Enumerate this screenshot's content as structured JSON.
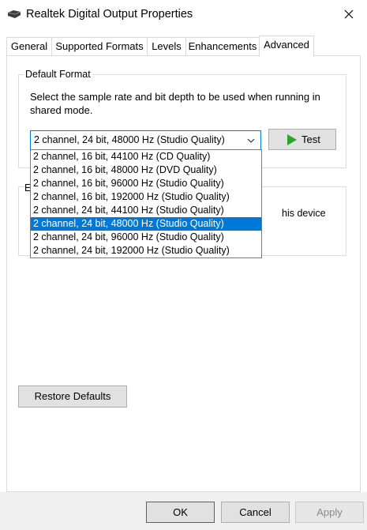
{
  "window": {
    "title": "Realtek Digital Output Properties",
    "icon": "speaker-device-icon"
  },
  "tabs": [
    {
      "label": "General",
      "active": false
    },
    {
      "label": "Supported Formats",
      "active": false
    },
    {
      "label": "Levels",
      "active": false
    },
    {
      "label": "Enhancements",
      "active": false
    },
    {
      "label": "Advanced",
      "active": true
    }
  ],
  "default_format": {
    "group_label": "Default Format",
    "description": "Select the sample rate and bit depth to be used when running in shared mode.",
    "selected_value": "2 channel, 24 bit, 48000 Hz (Studio Quality)",
    "test_button": "Test",
    "options": [
      "2 channel, 16 bit, 44100 Hz (CD Quality)",
      "2 channel, 16 bit, 48000 Hz (DVD Quality)",
      "2 channel, 16 bit, 96000 Hz (Studio Quality)",
      "2 channel, 16 bit, 192000 Hz (Studio Quality)",
      "2 channel, 24 bit, 44100 Hz (Studio Quality)",
      "2 channel, 24 bit, 48000 Hz (Studio Quality)",
      "2 channel, 24 bit, 96000 Hz (Studio Quality)",
      "2 channel, 24 bit, 192000 Hz (Studio Quality)"
    ],
    "selected_index": 5
  },
  "exclusive_mode": {
    "group_label_partial": "E",
    "partial_text": "his device"
  },
  "buttons": {
    "restore_defaults": "Restore Defaults",
    "ok": "OK",
    "cancel": "Cancel",
    "apply": "Apply"
  },
  "colors": {
    "accent": "#0078d7",
    "play_green": "#2aa52a"
  }
}
